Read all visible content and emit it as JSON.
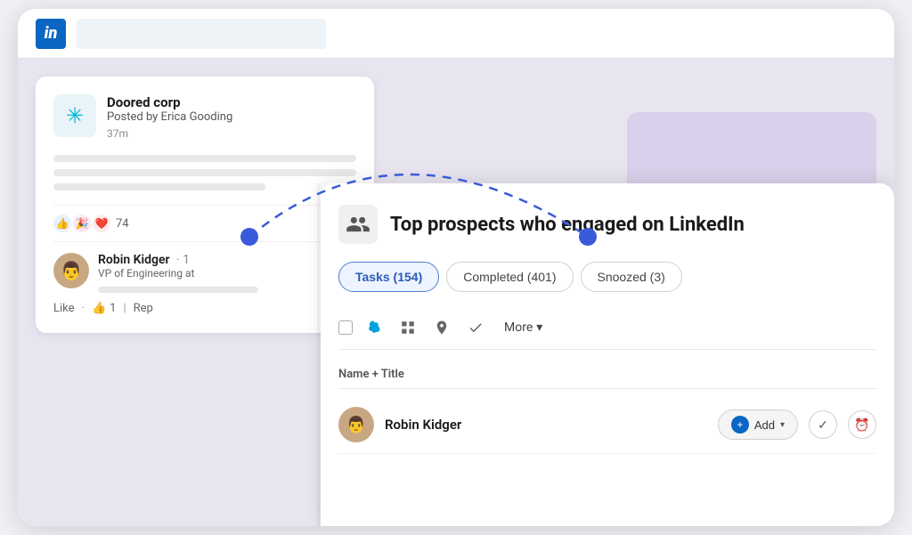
{
  "linkedin": {
    "logo_text": "in",
    "bar_bg": "#ffffff"
  },
  "post": {
    "company_name": "Doored corp",
    "posted_by": "Posted by Erica Gooding",
    "time_ago": "37m",
    "company_icon": "✳",
    "reaction_count": "74",
    "commenter_name": "Robin Kidger",
    "commenter_title": "VP of Engineering at",
    "like_label": "Like",
    "like_count": "1",
    "reply_label": "Rep"
  },
  "prospects": {
    "panel_title": "Top prospects who engaged on LinkedIn",
    "panel_icon": "👥",
    "tabs": [
      {
        "label": "Tasks (154)",
        "active": true
      },
      {
        "label": "Completed (401)",
        "active": false
      },
      {
        "label": "Snoozed (3)",
        "active": false
      }
    ],
    "toolbar": {
      "more_label": "More",
      "more_chevron": "▾"
    },
    "table_header": {
      "name_title_col": "Name + Title"
    },
    "prospects": [
      {
        "name": "Robin Kidger",
        "add_label": "Add",
        "avatar_emoji": "👨"
      }
    ]
  }
}
